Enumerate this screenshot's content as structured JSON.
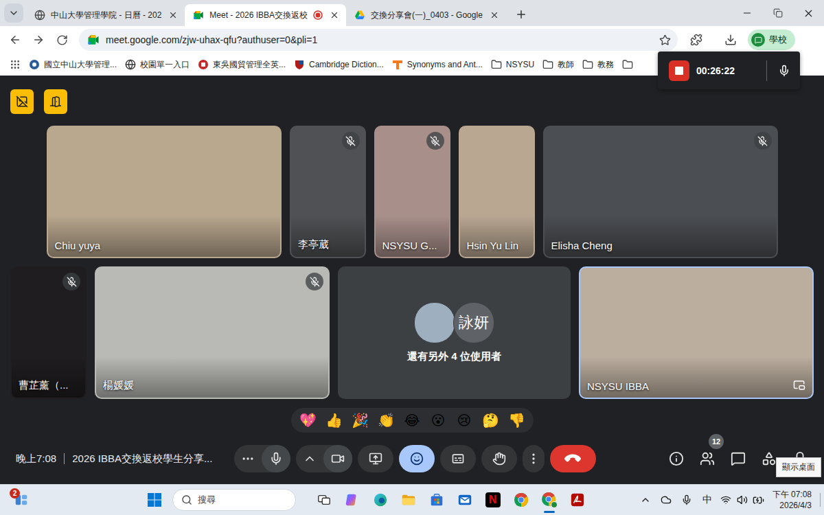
{
  "browser": {
    "tabs": [
      {
        "title": "中山大學管理學院 - 日曆 - 202",
        "kind": "calendar",
        "selected": false,
        "recording": false
      },
      {
        "title": "Meet - 2026 IBBA交換返校",
        "kind": "meet",
        "selected": true,
        "recording": true
      },
      {
        "title": "交換分享會(一)_0403 - Google",
        "kind": "drive",
        "selected": false,
        "recording": false
      }
    ],
    "url": "meet.google.com/zjw-uhax-qfu?authuser=0&pli=1",
    "bookmarked": false,
    "profile": "學校",
    "bookmarks": [
      {
        "label": "國立中山大學管理...",
        "kind": "nsysu"
      },
      {
        "label": "校園單一入口",
        "kind": "portal"
      },
      {
        "label": "東吳國貿管理全英...",
        "kind": "scu"
      },
      {
        "label": "Cambridge Diction...",
        "kind": "cambridge"
      },
      {
        "label": "Synonyms and Ant...",
        "kind": "thesaurus"
      },
      {
        "label": "NSYSU",
        "kind": "folder"
      },
      {
        "label": "教師",
        "kind": "folder"
      },
      {
        "label": "教務",
        "kind": "folder"
      }
    ]
  },
  "recording": {
    "elapsed": "00:26:22",
    "active": true
  },
  "meet": {
    "rows": [
      {
        "tiles": [
          {
            "name": "Chiu yuya",
            "kind": "landscape",
            "muted": false,
            "highlighted": false,
            "color": "#b9a78e"
          },
          {
            "name": "李亭葳",
            "kind": "portrait",
            "muted": true,
            "highlighted": false,
            "color": "#4f5154"
          },
          {
            "name": "NSYSU G...",
            "kind": "portrait",
            "muted": true,
            "highlighted": false,
            "color": "#a88f8a"
          },
          {
            "name": "Hsin Yu Lin",
            "kind": "portrait",
            "muted": false,
            "highlighted": false,
            "color": "#b9a792"
          },
          {
            "name": "Elisha Cheng",
            "kind": "landscape",
            "muted": true,
            "highlighted": false,
            "color": "#4b4e52"
          }
        ]
      },
      {
        "tiles": [
          {
            "name": "曹芷薰（...",
            "kind": "portrait",
            "muted": true,
            "highlighted": false,
            "color": "#1f1d1f"
          },
          {
            "name": "楊媛媛",
            "kind": "landscape",
            "muted": true,
            "highlighted": false,
            "color": "#b9b9b5"
          },
          {
            "text": "還有另外 4 位使用者",
            "kind": "overflow",
            "muted": false,
            "highlighted": false,
            "color": "#3c4043",
            "avatars": [
              {
                "kind": "photo",
                "color": "#9eafbf"
              },
              {
                "kind": "initials",
                "label": "詠妍",
                "color": "#5f6368"
              }
            ]
          },
          {
            "name": "NSYSU IBBA",
            "kind": "landscape",
            "muted": false,
            "highlighted": true,
            "color": "#bcae9f"
          }
        ]
      }
    ],
    "reactions": [
      "💖",
      "👍",
      "🎉",
      "👏",
      "😂",
      "😮",
      "😢",
      "🤔",
      "👎"
    ],
    "footer": {
      "time": "晚上7:08",
      "title": "2026 IBBA交換返校學生分享...",
      "mic": {
        "muted": false
      },
      "camera": {
        "off": false
      },
      "controls": [
        {
          "kind": "present",
          "selected": false
        },
        {
          "kind": "reactions",
          "selected": true
        },
        {
          "kind": "captions",
          "selected": false
        },
        {
          "kind": "hand",
          "selected": false
        },
        {
          "kind": "more",
          "selected": false
        },
        {
          "kind": "leave",
          "selected": false
        }
      ],
      "people_count": "12"
    },
    "tooltip": "顯示桌面"
  },
  "taskbar": {
    "notifications": "2",
    "search_placeholder": "搜尋",
    "apps": [
      {
        "kind": "taskview",
        "selected": false
      },
      {
        "kind": "copilot",
        "selected": false
      },
      {
        "kind": "edge",
        "selected": false
      },
      {
        "kind": "explorer",
        "selected": false
      },
      {
        "kind": "store",
        "selected": false
      },
      {
        "kind": "outlook",
        "selected": false
      },
      {
        "kind": "netflix",
        "label": "N",
        "selected": false
      },
      {
        "kind": "chrome",
        "selected": false
      },
      {
        "kind": "chrome-profile",
        "selected": true
      },
      {
        "kind": "acrobat",
        "selected": false
      }
    ],
    "tray": {
      "ime": "中",
      "time": "下午 07:08",
      "date": "2026/4/3"
    }
  }
}
